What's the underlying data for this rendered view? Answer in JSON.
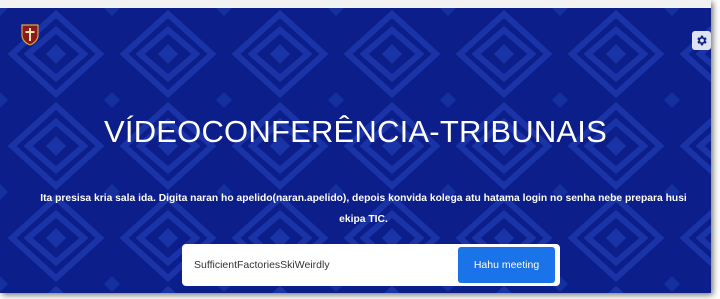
{
  "header": {
    "logo_icon": "tribunal-shield-logo-icon",
    "settings_icon": "gear-icon"
  },
  "hero": {
    "title": "VÍDEOCONFERÊNCIA-TRIBUNAIS",
    "description": "Ita presisa kria sala ida. Digita naran ho apelido(naran.apelido), depois konvida kolega atu hatama login no senha nebe prepara husi ekipa TIC."
  },
  "form": {
    "room_value": "SufficientFactoriesSkiWeirdly",
    "start_label": "Hahu meeting"
  },
  "colors": {
    "background": "#0b1e8a",
    "pattern": "#1a34a8",
    "button": "#1a73e8"
  }
}
